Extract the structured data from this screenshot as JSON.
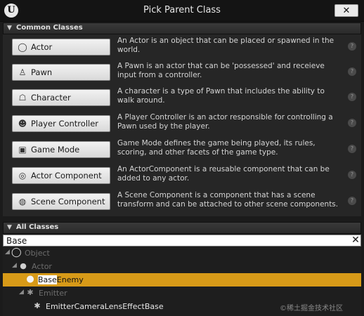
{
  "window": {
    "title": "Pick Parent Class",
    "close_label": "✕",
    "logo_letter": "U"
  },
  "common_classes": {
    "header": "Common Classes",
    "items": [
      {
        "label": "Actor",
        "icon": "actor-sphere-icon",
        "glyph": "◯",
        "description": "An Actor is an object that can be placed or spawned in the world."
      },
      {
        "label": "Pawn",
        "icon": "pawn-icon",
        "glyph": "♙",
        "description": "A Pawn is an actor that can be 'possessed' and receieve input from a controller."
      },
      {
        "label": "Character",
        "icon": "character-icon",
        "glyph": "☖",
        "description": "A character is a type of Pawn that includes the ability to walk around."
      },
      {
        "label": "Player Controller",
        "icon": "controller-icon",
        "glyph": "☻",
        "description": "A Player Controller is an actor responsible for controlling a Pawn used by the player."
      },
      {
        "label": "Game Mode",
        "icon": "game-mode-icon",
        "glyph": "▣",
        "description": "Game Mode defines the game being played, its rules, scoring, and other facets of the game type."
      },
      {
        "label": "Actor Component",
        "icon": "actor-component-icon",
        "glyph": "◎",
        "description": "An ActorComponent is a reusable component that can be added to any actor."
      },
      {
        "label": "Scene Component",
        "icon": "scene-component-icon",
        "glyph": "◍",
        "description": "A Scene Component is a component that has a scene transform and can be attached to other scene components."
      }
    ],
    "help_glyph": "?"
  },
  "all_classes": {
    "header": "All Classes",
    "search": {
      "value": "Base",
      "clear_label": "✕"
    },
    "tree": [
      {
        "label": "Object",
        "expander": "◢"
      },
      {
        "label": "Actor",
        "expander": "◢"
      },
      {
        "label_highlight": "Base",
        "label_rest": "Enemy"
      },
      {
        "label": "Emitter",
        "expander": "◢"
      },
      {
        "label": "EmitterCameraLensEffectBase"
      }
    ]
  },
  "watermark": "©稀土掘金技术社区",
  "colors": {
    "selection": "#d79a18",
    "background": "#1b1b1b"
  }
}
